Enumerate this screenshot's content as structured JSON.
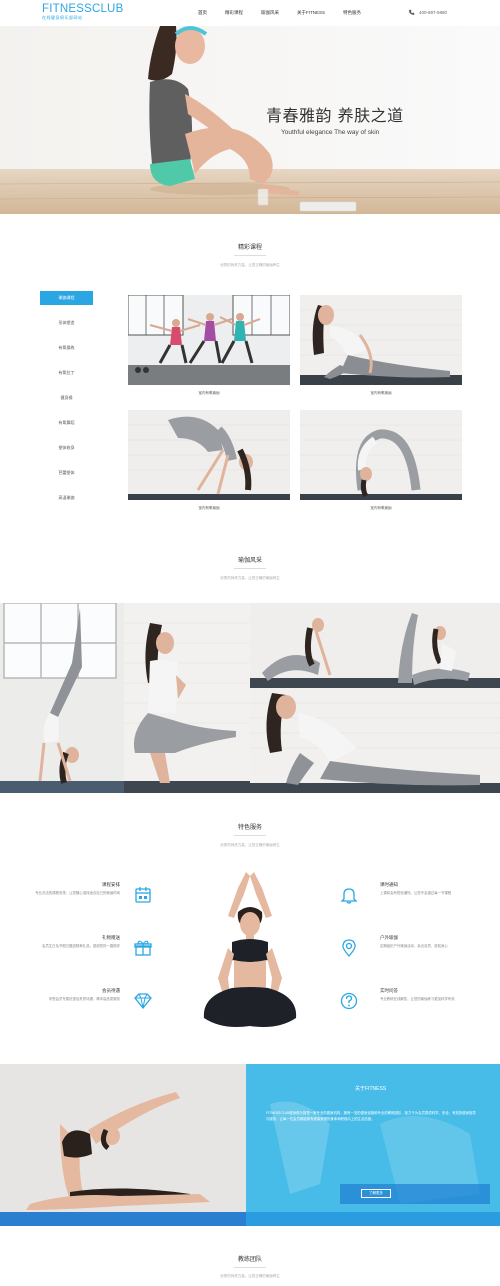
{
  "header": {
    "logo_main": "FITNESSCLUB",
    "logo_sub": "在线健身俱乐部网站",
    "nav": [
      "首页",
      "精彩课程",
      "瑜伽风采",
      "关于FITNESS",
      "特色服务"
    ],
    "phone": "400-897-5880"
  },
  "hero": {
    "title": "青春雅韵 养肤之道",
    "subtitle": "Youthful elegance  The way of skin"
  },
  "courses": {
    "title": "精彩课程",
    "subtitle": "优秀的师资力量，让您正确的瑜伽养生",
    "sidebar": [
      "瑜伽课程",
      "形体塑造",
      "有氧操练",
      "有氧拉丁",
      "健身操",
      "有氧舞蹈",
      "塑体修身",
      "芭蕾塑体",
      "高温瑜伽"
    ],
    "cards": [
      {
        "caption": "室内有氧瑜伽"
      },
      {
        "caption": "室内有氧瑜伽"
      },
      {
        "caption": "室内有氧瑜伽"
      },
      {
        "caption": "室内有氧瑜伽"
      }
    ]
  },
  "gallery": {
    "title": "瑜伽风采",
    "subtitle": "优秀的师资力量，让您正确的瑜伽养生"
  },
  "services": {
    "title": "特色服务",
    "subtitle": "优秀的师资力量，让您正确的瑜伽养生",
    "items": [
      {
        "title": "课程安排",
        "desc": "专业灵活的课程安排，让您随心选择适合自己的瑜伽时间",
        "icon": "calendar-icon"
      },
      {
        "title": "礼物赠送",
        "desc": "会员生日及节假日赠送精美礼品，感谢您的一路陪伴",
        "icon": "gift-icon"
      },
      {
        "title": "会员待遇",
        "desc": "享受会员专属优惠及贵宾待遇，尊享高品质服务",
        "icon": "diamond-icon"
      },
      {
        "title": "课时通知",
        "desc": "上课前会有短信通知，让您不会错过每一节课程",
        "icon": "bell-icon"
      },
      {
        "title": "户外瑜伽",
        "desc": "定期组织户外瑜伽活动，亲近自然，放松身心",
        "icon": "location-icon"
      },
      {
        "title": "实时问答",
        "desc": "专业教练在线解答，让您的瑜伽练习更加科学有效",
        "icon": "question-icon"
      }
    ]
  },
  "about": {
    "title": "关于FITNESS",
    "text": "FITNESSCLUB健身俱乐部是一家专业的健身机构，拥有一流的健身设施和专业的教练团队，致力于为会员提供科学、安全、有效的健身指导与服务，让每一位会员都能拥有健康美丽的身体和积极向上的生活态度。",
    "button": "了解更多"
  },
  "team": {
    "title": "教练团队",
    "subtitle": "优秀的师资力量，让您正确的瑜伽养生"
  },
  "colors": {
    "accent": "#2aa7e3"
  }
}
